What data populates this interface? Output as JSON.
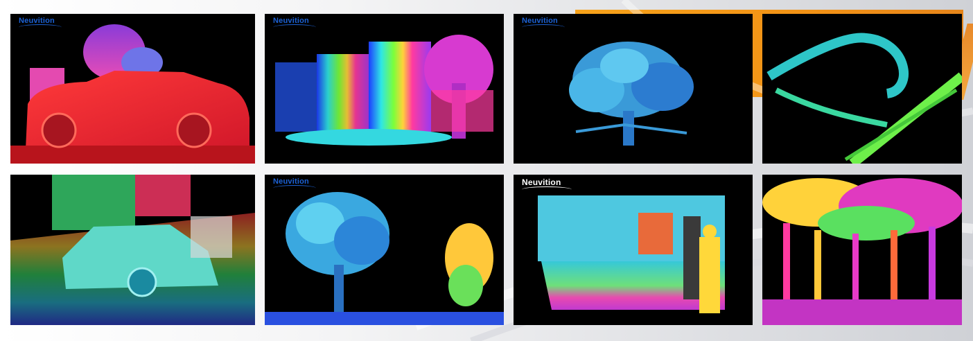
{
  "brand": {
    "logo_text": "Neuvition"
  },
  "tiles": [
    {
      "id": "car-side",
      "subject": "car"
    },
    {
      "id": "building-street",
      "subject": "building"
    },
    {
      "id": "single-tree",
      "subject": "tree"
    },
    {
      "id": "overpass-ramp",
      "subject": "road overpass"
    },
    {
      "id": "suv-street",
      "subject": "suv"
    },
    {
      "id": "two-trees",
      "subject": "trees"
    },
    {
      "id": "people-building",
      "subject": "people"
    },
    {
      "id": "forest",
      "subject": "forest"
    }
  ],
  "colors": {
    "accent_orange": "#f29216",
    "logo_blue": "#1c62d6",
    "tile_background": "#000000"
  }
}
